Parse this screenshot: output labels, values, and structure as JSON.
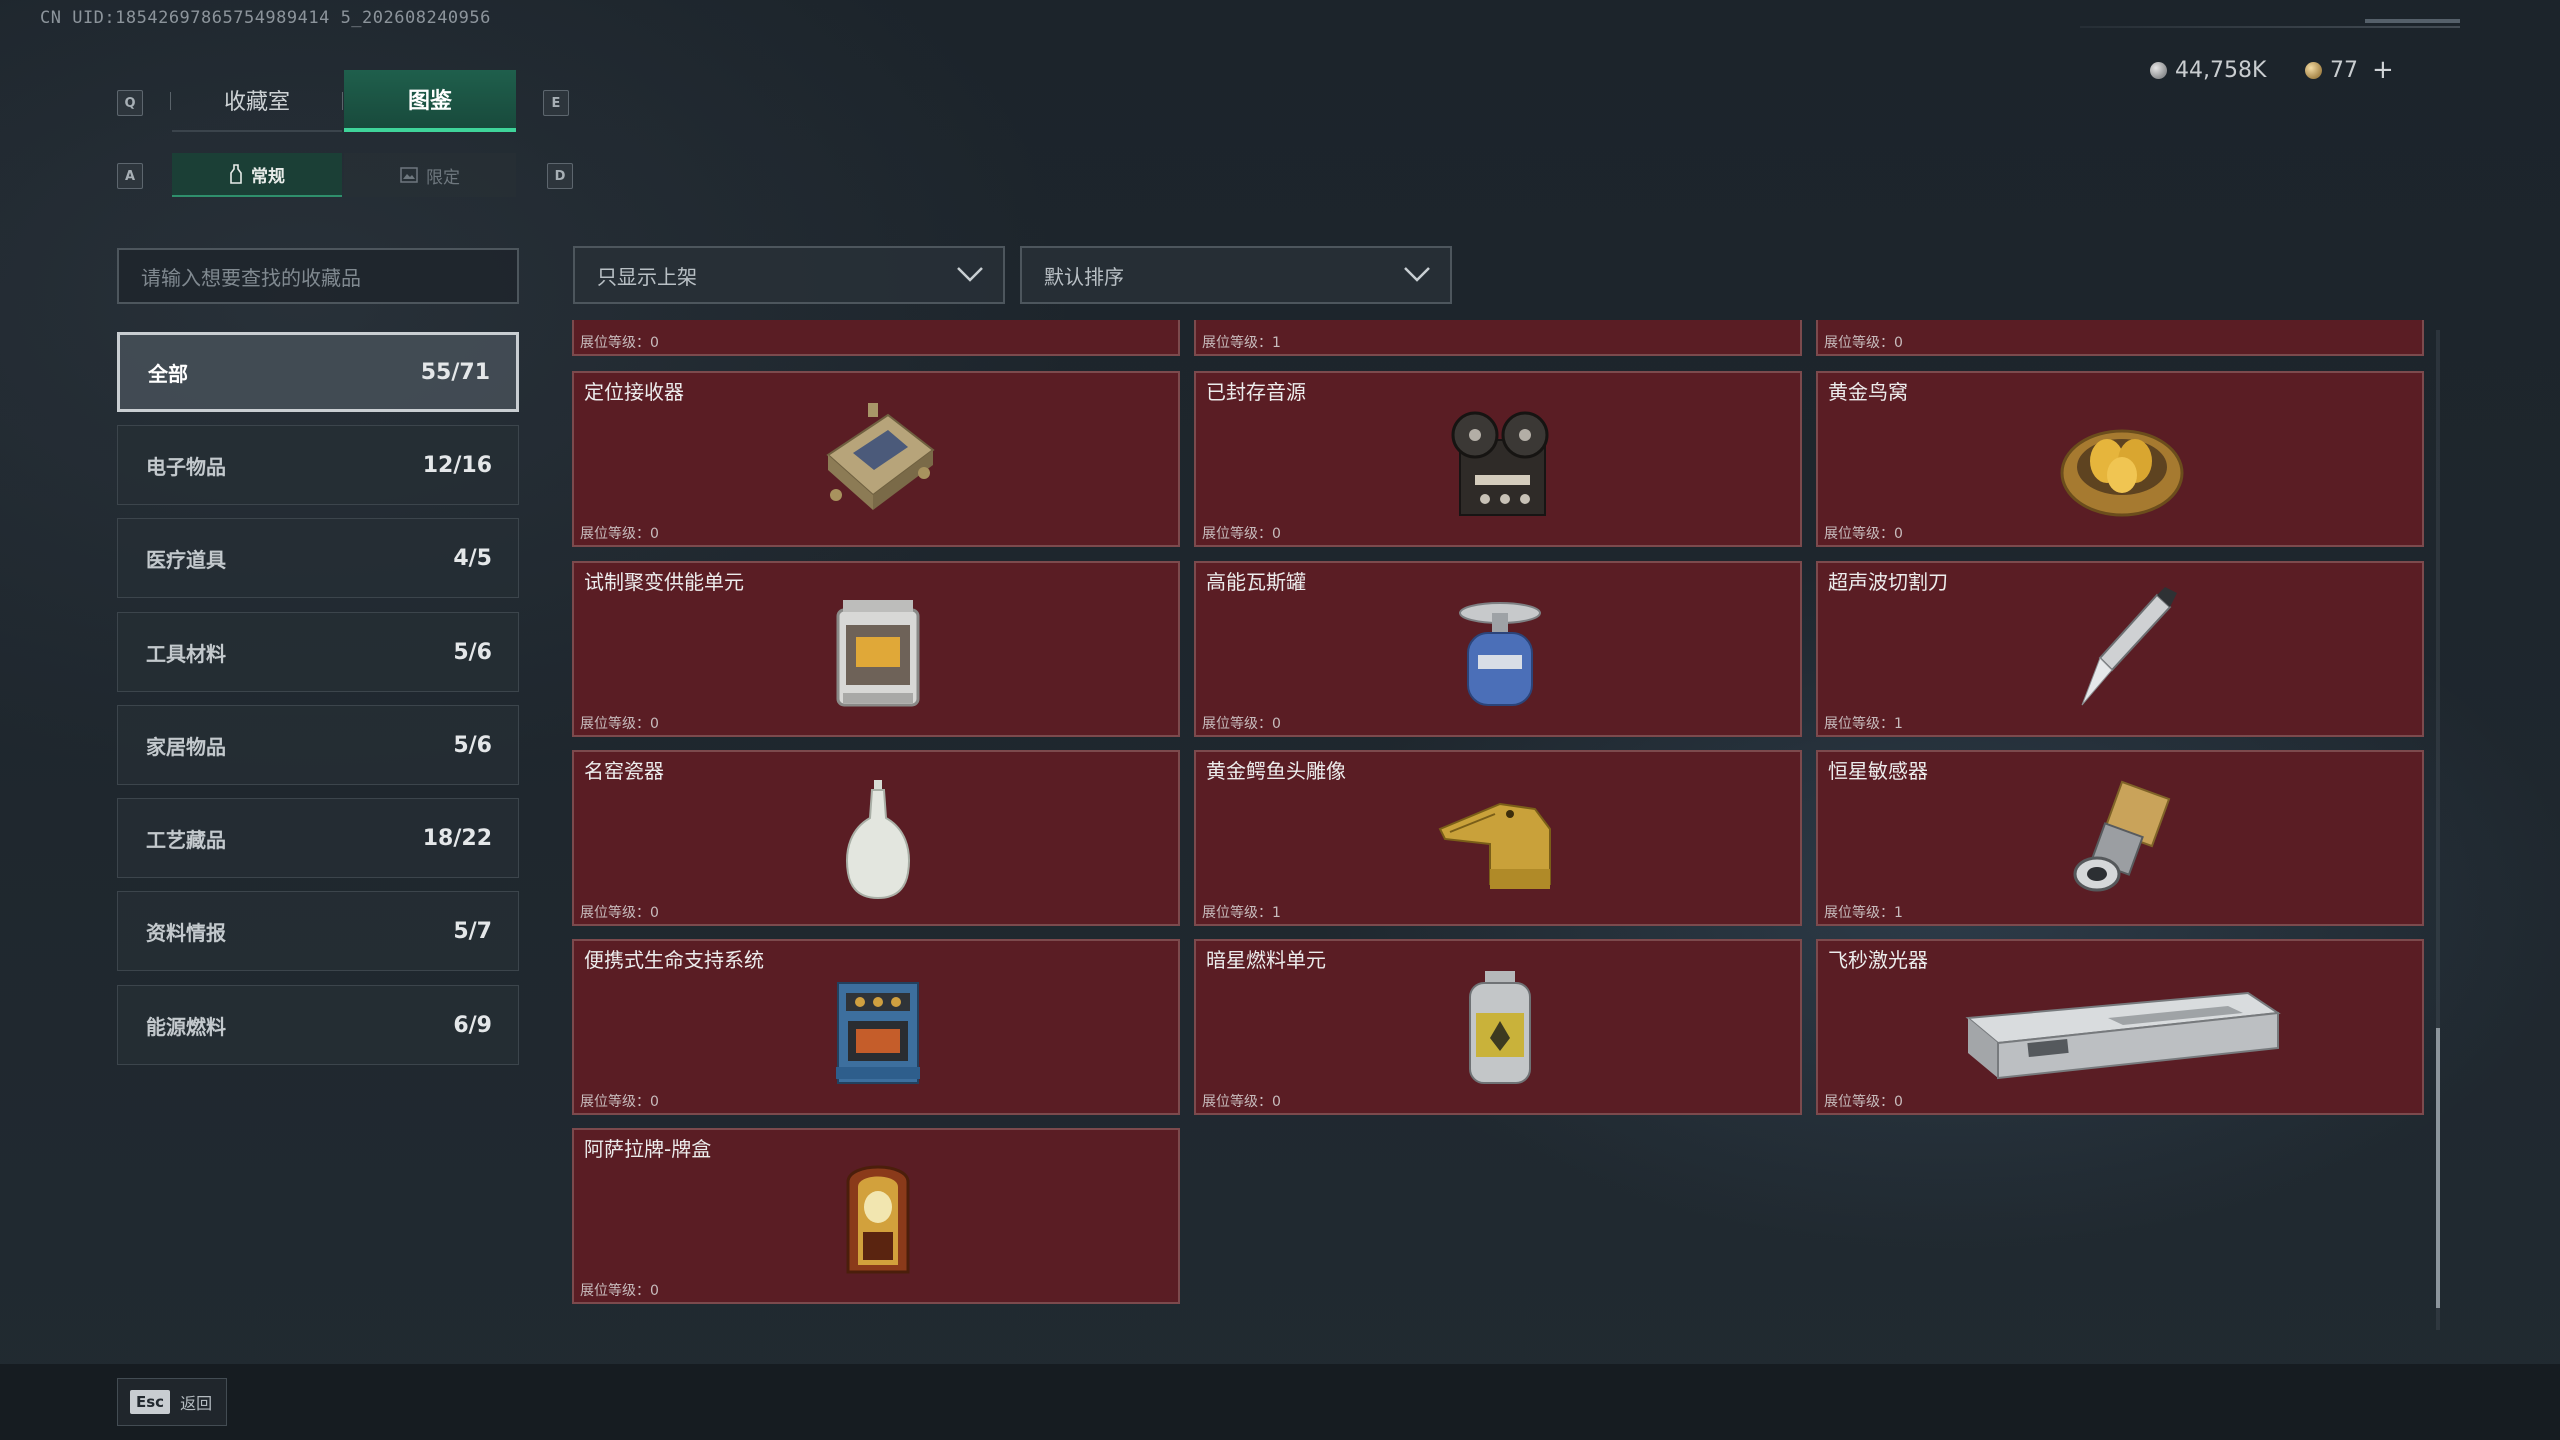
{
  "uid_text": "CN UID:18542697865754989414 5_202608240956",
  "currency": {
    "silver": "44,758K",
    "gold": "77",
    "plus": "+"
  },
  "keyhints": {
    "prev_tab": "Q",
    "next_tab": "E",
    "prev_sub": "A",
    "next_sub": "D"
  },
  "main_tabs": [
    "收藏室",
    "图鉴"
  ],
  "sub_tabs": [
    "常规",
    "限定"
  ],
  "search_placeholder": "请输入想要查找的收藏品",
  "filters": {
    "show": "只显示上架",
    "sort": "默认排序"
  },
  "categories": [
    {
      "label": "全部",
      "count": "55/71"
    },
    {
      "label": "电子物品",
      "count": "12/16"
    },
    {
      "label": "医疗道具",
      "count": "4/5"
    },
    {
      "label": "工具材料",
      "count": "5/6"
    },
    {
      "label": "家居物品",
      "count": "5/6"
    },
    {
      "label": "工艺藏品",
      "count": "18/22"
    },
    {
      "label": "资料情报",
      "count": "5/7"
    },
    {
      "label": "能源燃料",
      "count": "6/9"
    }
  ],
  "items": [
    {
      "name": "",
      "level": "展位等级：0",
      "icon": "partial-item"
    },
    {
      "name": "",
      "level": "展位等级：1",
      "icon": "partial-item"
    },
    {
      "name": "",
      "level": "展位等级：0",
      "icon": "partial-item"
    },
    {
      "name": "定位接收器",
      "level": "展位等级：0",
      "icon": "receiver-icon"
    },
    {
      "name": "已封存音源",
      "level": "展位等级：0",
      "icon": "tape-recorder-icon"
    },
    {
      "name": "黄金鸟窝",
      "level": "展位等级：0",
      "icon": "golden-nest-icon"
    },
    {
      "name": "试制聚变供能单元",
      "level": "展位等级：0",
      "icon": "fusion-unit-icon"
    },
    {
      "name": "高能瓦斯罐",
      "level": "展位等级：0",
      "icon": "gas-canister-icon"
    },
    {
      "name": "超声波切割刀",
      "level": "展位等级：1",
      "icon": "cutter-icon"
    },
    {
      "name": "名窑瓷器",
      "level": "展位等级：0",
      "icon": "porcelain-vase-icon"
    },
    {
      "name": "黄金鳄鱼头雕像",
      "level": "展位等级：1",
      "icon": "croc-statue-icon"
    },
    {
      "name": "恒星敏感器",
      "level": "展位等级：1",
      "icon": "star-sensor-icon"
    },
    {
      "name": "便携式生命支持系统",
      "level": "展位等级：0",
      "icon": "life-support-icon"
    },
    {
      "name": "暗星燃料单元",
      "level": "展位等级：0",
      "icon": "fuel-cell-icon"
    },
    {
      "name": "飞秒激光器",
      "level": "展位等级：0",
      "icon": "laser-box-icon"
    },
    {
      "name": "阿萨拉牌-牌盒",
      "level": "展位等级：0",
      "icon": "card-box-icon"
    }
  ],
  "footer": {
    "esc_key": "Esc",
    "esc_label": "返回"
  },
  "colors": {
    "accent": "#3fd49a",
    "card_bg": "#5a1d24",
    "card_border": "#7c4a4d"
  }
}
